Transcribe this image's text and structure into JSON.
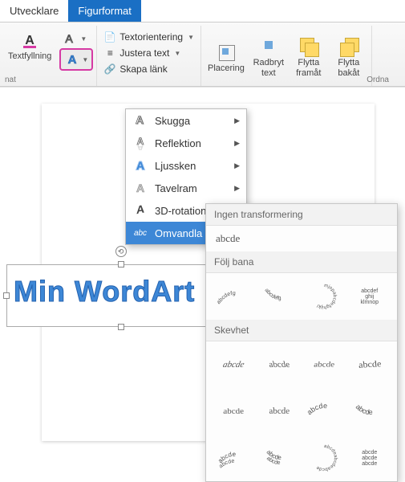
{
  "tabs": {
    "developer": "Utvecklare",
    "shapeformat": "Figurformat"
  },
  "ribbon": {
    "textfill": "Textfyllning",
    "textorient": "Textorientering",
    "aligntext": "Justera text",
    "createlink": "Skapa länk",
    "position": "Placering",
    "wraptext": "Radbryt\ntext",
    "bringfwd": "Flytta\nframåt",
    "sendback": "Flytta\nbakåt",
    "group_left": "nat",
    "group_right": "Ordna"
  },
  "effects_menu": {
    "shadow": "Skugga",
    "reflection": "Reflektion",
    "glow": "Ljussken",
    "bevel": "Tavelram",
    "rotation3d": "3D-rotation",
    "transform": "Omvandla"
  },
  "transform_panel": {
    "no_transform": "Ingen transformering",
    "sample": "abcde",
    "follow_path": "Följ bana",
    "warp": "Skevhet",
    "cell": "abcde"
  },
  "wordart": {
    "text": "Min WordArt"
  }
}
